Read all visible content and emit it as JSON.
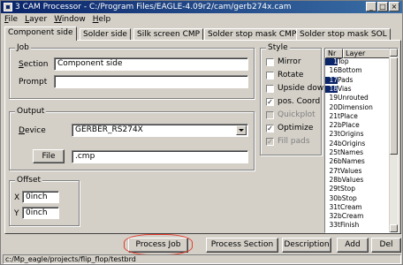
{
  "window": {
    "title": "3 CAM Processor - C:/Program Files/EAGLE-4.09r2/cam/gerb274x.cam",
    "minimize": "_",
    "maximize": "□",
    "close": "×"
  },
  "menu": [
    "File",
    "Layer",
    "Window",
    "Help"
  ],
  "tabs": [
    "Component side",
    "Solder side",
    "Silk screen CMP",
    "Solder stop mask CMP",
    "Solder stop mask SOL"
  ],
  "job": {
    "group_label": "Job",
    "section_label": "Section",
    "section_value": "Component side",
    "prompt_label": "Prompt",
    "prompt_value": ""
  },
  "output": {
    "group_label": "Output",
    "device_label": "Device",
    "device_value": "GERBER_RS274X",
    "file_button": "File",
    "file_value": ".cmp"
  },
  "offset": {
    "group_label": "Offset",
    "x_label": "X",
    "x_value": "0inch",
    "y_label": "Y",
    "y_value": "0inch"
  },
  "style": {
    "group_label": "Style",
    "options": [
      {
        "label": "Mirror",
        "checked": false,
        "disabled": false
      },
      {
        "label": "Rotate",
        "checked": false,
        "disabled": false
      },
      {
        "label": "Upside down",
        "checked": false,
        "disabled": false
      },
      {
        "label": "pos. Coord",
        "checked": true,
        "disabled": false
      },
      {
        "label": "Quickplot",
        "checked": false,
        "disabled": true
      },
      {
        "label": "Optimize",
        "checked": true,
        "disabled": false
      },
      {
        "label": "Fill pads",
        "checked": true,
        "disabled": true
      }
    ]
  },
  "layers": {
    "header_nr": "Nr",
    "header_layer": "Layer",
    "rows": [
      {
        "nr": "1",
        "name": "Top",
        "selected": true
      },
      {
        "nr": "16",
        "name": "Bottom",
        "selected": false
      },
      {
        "nr": "17",
        "name": "Pads",
        "selected": true
      },
      {
        "nr": "18",
        "name": "Vias",
        "selected": true
      },
      {
        "nr": "19",
        "name": "Unrouted",
        "selected": false
      },
      {
        "nr": "20",
        "name": "Dimension",
        "selected": false
      },
      {
        "nr": "21",
        "name": "tPlace",
        "selected": false
      },
      {
        "nr": "22",
        "name": "bPlace",
        "selected": false
      },
      {
        "nr": "23",
        "name": "tOrigins",
        "selected": false
      },
      {
        "nr": "24",
        "name": "bOrigins",
        "selected": false
      },
      {
        "nr": "25",
        "name": "tNames",
        "selected": false
      },
      {
        "nr": "26",
        "name": "bNames",
        "selected": false
      },
      {
        "nr": "27",
        "name": "tValues",
        "selected": false
      },
      {
        "nr": "28",
        "name": "bValues",
        "selected": false
      },
      {
        "nr": "29",
        "name": "tStop",
        "selected": false
      },
      {
        "nr": "30",
        "name": "bStop",
        "selected": false
      },
      {
        "nr": "31",
        "name": "tCream",
        "selected": false
      },
      {
        "nr": "32",
        "name": "bCream",
        "selected": false
      },
      {
        "nr": "33",
        "name": "tFinish",
        "selected": false
      }
    ]
  },
  "buttons": {
    "process_job": "Process Job",
    "process_section": "Process Section",
    "description": "Description",
    "add": "Add",
    "del": "Del"
  },
  "status": "c:/Mp_eagle/projects/flip_flop/testbrd",
  "colors": {
    "face": "#d4d0c8",
    "title_start": "#0a246a",
    "selection": "#0a246a",
    "highlight_circle": "#e53b2c"
  }
}
